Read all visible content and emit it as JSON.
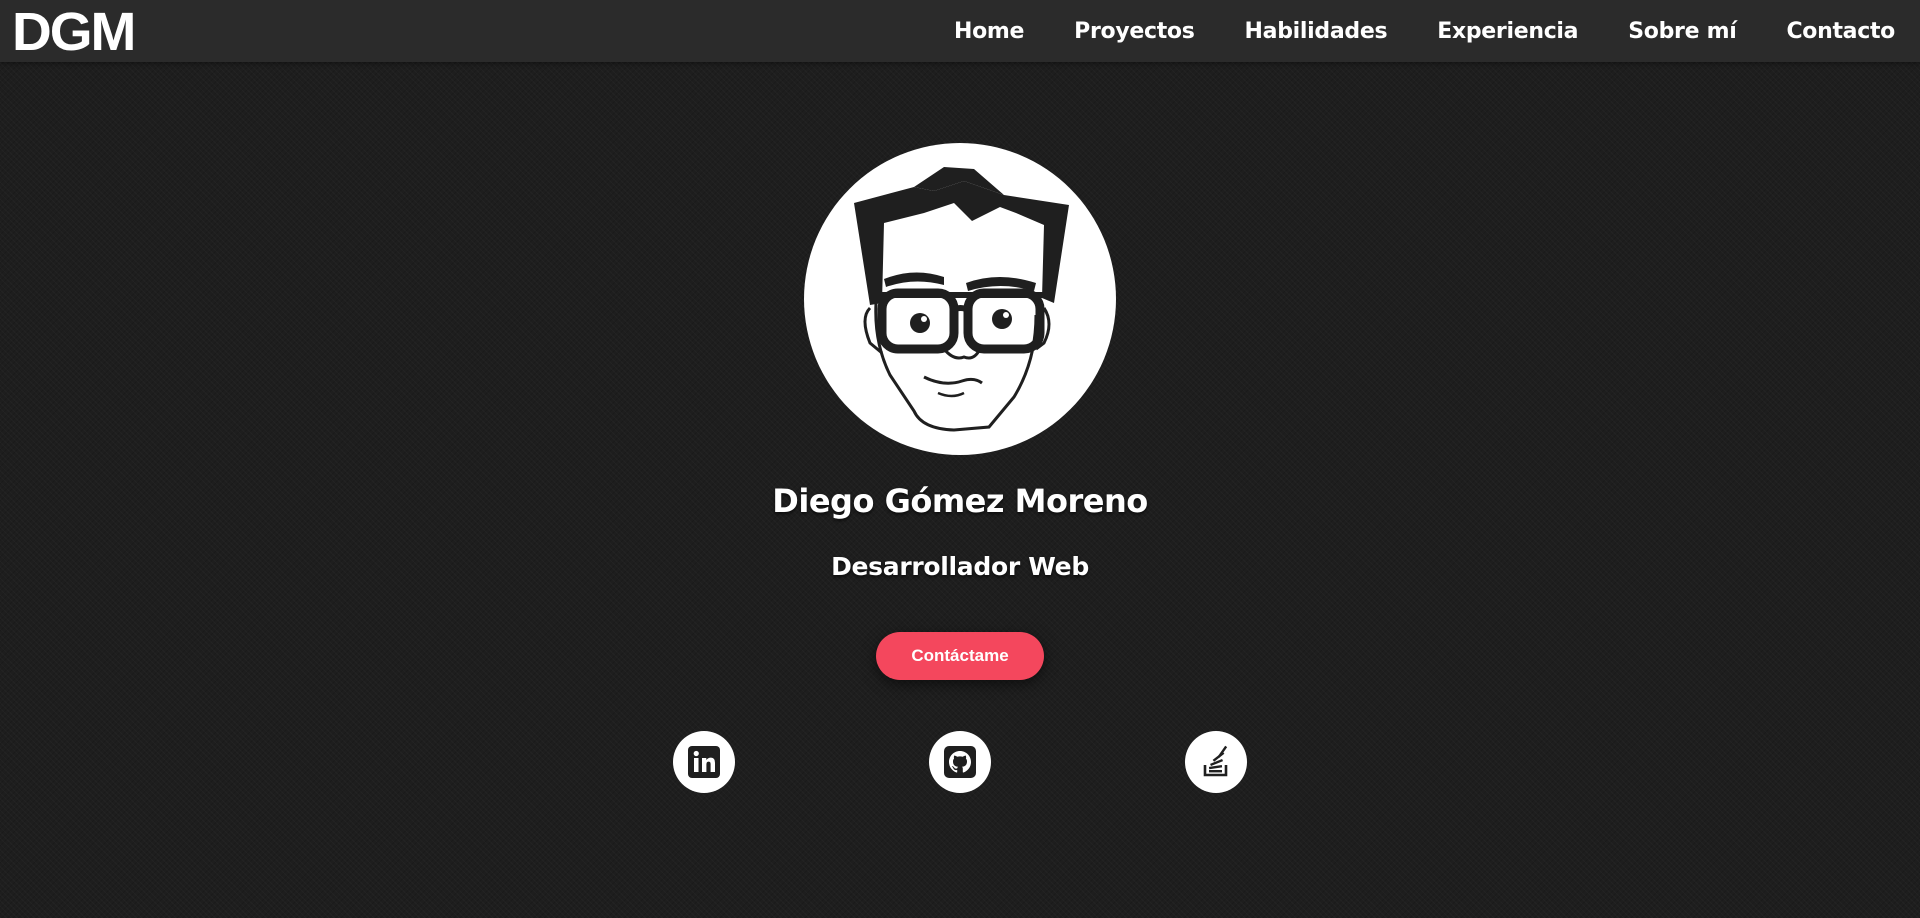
{
  "header": {
    "logo": "DGM",
    "nav": [
      {
        "label": "Home"
      },
      {
        "label": "Proyectos"
      },
      {
        "label": "Habilidades"
      },
      {
        "label": "Experiencia"
      },
      {
        "label": "Sobre mí"
      },
      {
        "label": "Contacto"
      }
    ]
  },
  "hero": {
    "avatar_icon": "cartoon-face-with-glasses",
    "name": "Diego Gómez Moreno",
    "role": "Desarrollador Web",
    "cta_label": "Contáctame"
  },
  "social": [
    {
      "icon": "linkedin-icon"
    },
    {
      "icon": "github-icon"
    },
    {
      "icon": "stackoverflow-icon"
    }
  ],
  "colors": {
    "background": "#1e1e1e",
    "navbar": "#2b2b2b",
    "accent": "#f4475d",
    "text": "#ffffff"
  }
}
